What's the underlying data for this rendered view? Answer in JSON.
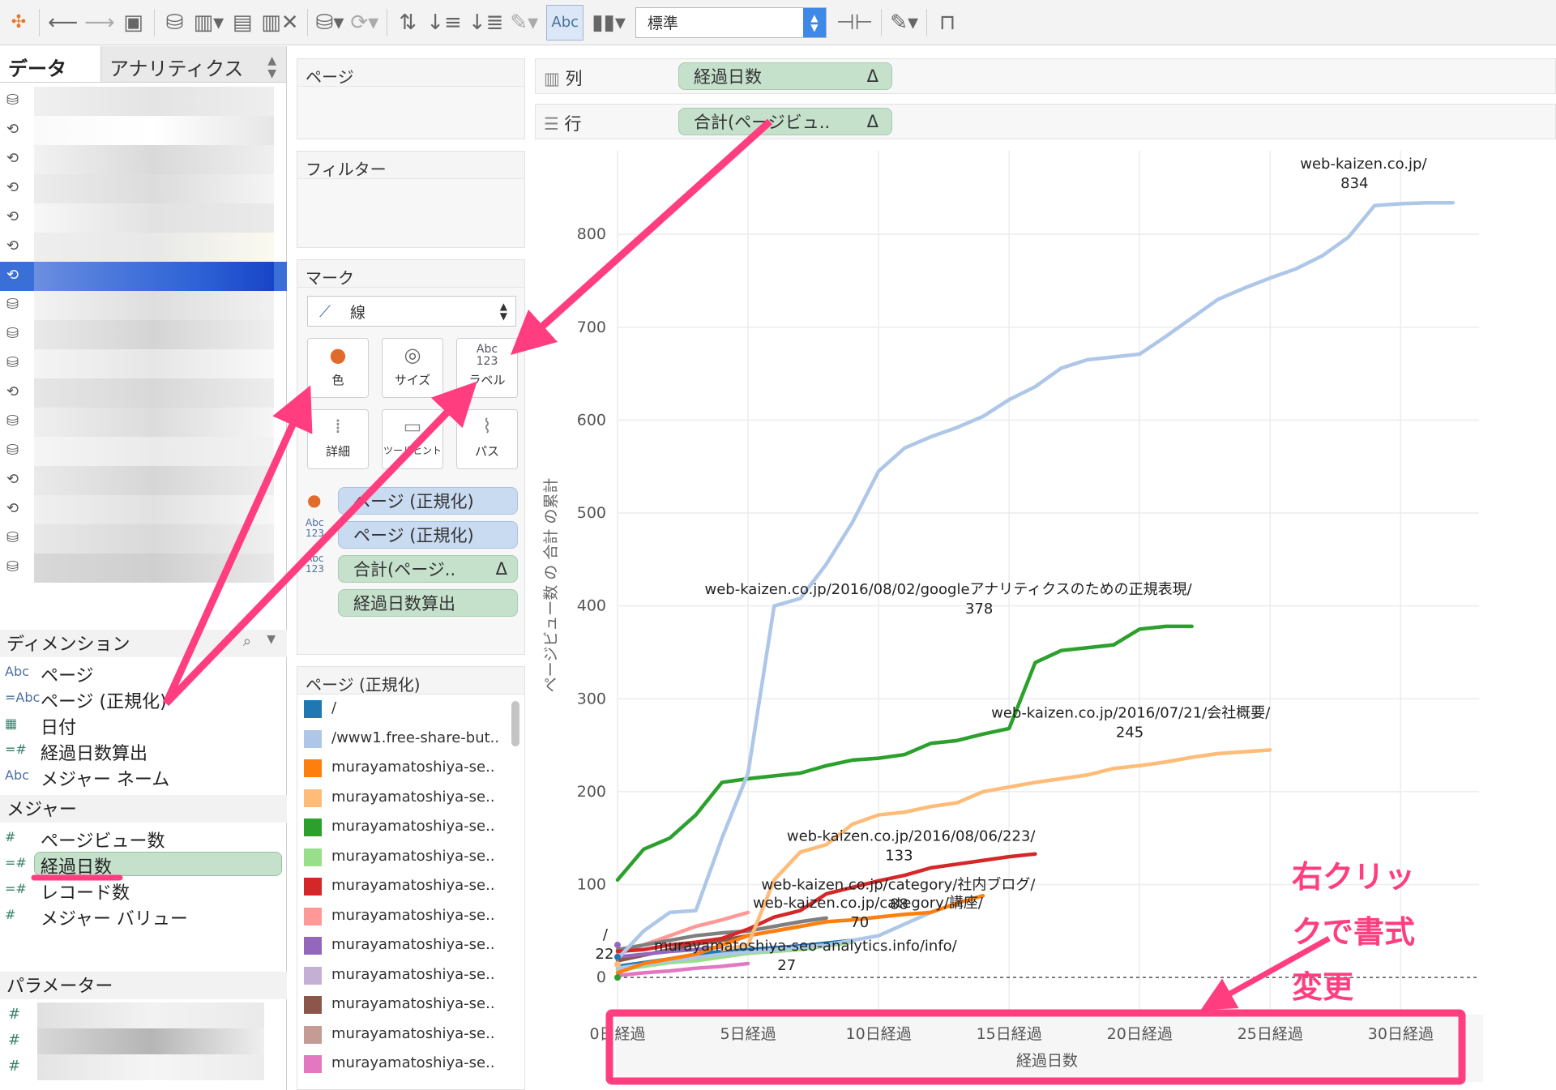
{
  "toolbar": {
    "abc_label": "Abc",
    "fit_select": "標準"
  },
  "left_panel": {
    "tabs": [
      "データ",
      "アナリティクス"
    ],
    "dimensions_header": "ディメンション",
    "dimensions": [
      {
        "type": "Abc",
        "name": "ページ"
      },
      {
        "type": "=Abc",
        "name": "ページ (正規化)"
      },
      {
        "type": "date",
        "name": "日付"
      },
      {
        "type": "=#",
        "name": "経過日数算出"
      },
      {
        "type": "Abc",
        "name": "メジャー ネーム"
      }
    ],
    "measures_header": "メジャー",
    "measures": [
      {
        "type": "#",
        "name": "ページビュー数"
      },
      {
        "type": "=#",
        "name": "経過日数"
      },
      {
        "type": "=#",
        "name": "レコード数"
      },
      {
        "type": "#",
        "name": "メジャー バリュー"
      }
    ],
    "parameters_header": "パラメーター"
  },
  "cards": {
    "pages": "ページ",
    "filters": "フィルター",
    "marks": "マーク",
    "mark_type": "線",
    "buttons": [
      "色",
      "サイズ",
      "ラベル",
      "詳細",
      "ツールヒント",
      "パス"
    ],
    "label_icon": [
      "Abc",
      "123"
    ],
    "mark_pills": [
      "ページ (正規化)",
      "ページ (正規化)",
      "合計(ページ..",
      "経過日数算出"
    ],
    "legend_title": "ページ (正規化)",
    "legend": [
      {
        "label": "/",
        "color": "#1f77b4"
      },
      {
        "label": "/www1.free-share-but..",
        "color": "#aec7e8"
      },
      {
        "label": "murayamatoshiya-se..",
        "color": "#ff7f0e"
      },
      {
        "label": "murayamatoshiya-se..",
        "color": "#ffbb78"
      },
      {
        "label": "murayamatoshiya-se..",
        "color": "#2ca02c"
      },
      {
        "label": "murayamatoshiya-se..",
        "color": "#98df8a"
      },
      {
        "label": "murayamatoshiya-se..",
        "color": "#d62728"
      },
      {
        "label": "murayamatoshiya-se..",
        "color": "#ff9896"
      },
      {
        "label": "murayamatoshiya-se..",
        "color": "#9467bd"
      },
      {
        "label": "murayamatoshiya-se..",
        "color": "#c5b0d5"
      },
      {
        "label": "murayamatoshiya-se..",
        "color": "#8c564b"
      },
      {
        "label": "murayamatoshiya-se..",
        "color": "#c49c94"
      },
      {
        "label": "murayamatoshiya-se..",
        "color": "#e377c2"
      }
    ]
  },
  "shelves": {
    "columns_label": "列",
    "columns_pill": "経過日数",
    "rows_label": "行",
    "rows_pill": "合計(ページビュ..",
    "delta": "Δ"
  },
  "chart_data": {
    "type": "line",
    "ylabel": "ページビュー数 の 合計 の累計",
    "xlabel": "経過日数",
    "ylim": [
      -40,
      890
    ],
    "xlim": [
      0,
      33
    ],
    "y_ticks": [
      0,
      100,
      200,
      300,
      400,
      500,
      600,
      700,
      800
    ],
    "x_ticks": [
      {
        "v": 0,
        "label": "0日経過"
      },
      {
        "v": 5,
        "label": "5日経過"
      },
      {
        "v": 10,
        "label": "10日経過"
      },
      {
        "v": 15,
        "label": "15日経過"
      },
      {
        "v": 20,
        "label": "20日経過"
      },
      {
        "v": 25,
        "label": "25日経過"
      },
      {
        "v": 30,
        "label": "30日経過"
      }
    ],
    "series": [
      {
        "color": "#aec7e8",
        "x": [
          0,
          1,
          2,
          3,
          4,
          5,
          6,
          7,
          8,
          9,
          10,
          11,
          12,
          13,
          14,
          15,
          16,
          17,
          18,
          19,
          20,
          21,
          22,
          23,
          24,
          25,
          26,
          27,
          28,
          29,
          30,
          31,
          32
        ],
        "y": [
          20,
          50,
          70,
          72,
          150,
          220,
          400,
          408,
          445,
          490,
          545,
          570,
          582,
          592,
          604,
          622,
          636,
          656,
          665,
          668,
          671,
          690,
          710,
          730,
          742,
          753,
          763,
          777,
          797,
          831,
          833,
          834,
          834
        ]
      },
      {
        "color": "#2ca02c",
        "x": [
          0,
          1,
          2,
          3,
          4,
          5,
          6,
          7,
          8,
          9,
          10,
          11,
          12,
          13,
          14,
          15,
          16,
          17,
          18,
          19,
          20,
          21,
          22
        ],
        "y": [
          105,
          138,
          150,
          175,
          210,
          214,
          217,
          220,
          228,
          234,
          236,
          240,
          252,
          255,
          262,
          268,
          339,
          352,
          355,
          358,
          375,
          378,
          378
        ]
      },
      {
        "color": "#ffbb78",
        "x": [
          4,
          5,
          6,
          7,
          8,
          9,
          10,
          11,
          12,
          13,
          14,
          15,
          16,
          17,
          18,
          19,
          20,
          21,
          22,
          23,
          24,
          25
        ],
        "y": [
          30,
          35,
          105,
          135,
          143,
          165,
          175,
          178,
          184,
          188,
          200,
          205,
          210,
          214,
          218,
          225,
          228,
          232,
          237,
          241,
          243,
          245
        ]
      },
      {
        "color": "#d62728",
        "x": [
          0,
          1,
          2,
          3,
          4,
          5,
          6,
          7,
          8,
          9,
          10,
          11,
          12,
          13,
          14,
          15,
          16
        ],
        "y": [
          28,
          30,
          35,
          38,
          42,
          52,
          65,
          72,
          90,
          97,
          104,
          110,
          118,
          122,
          126,
          130,
          133
        ]
      },
      {
        "color": "#ff7f0e",
        "x": [
          0,
          1,
          2,
          3,
          4,
          5,
          6,
          7,
          8,
          9,
          10,
          11,
          12,
          13,
          14
        ],
        "y": [
          5,
          15,
          20,
          25,
          35,
          45,
          50,
          55,
          60,
          62,
          65,
          68,
          70,
          80,
          88
        ]
      },
      {
        "color": "#aec7e8",
        "x": [
          0,
          2,
          4,
          6,
          8,
          10,
          12
        ],
        "y": [
          10,
          18,
          25,
          30,
          35,
          45,
          70
        ]
      },
      {
        "color": "#7f7f7f",
        "x": [
          0,
          1,
          2,
          3,
          4,
          5,
          6,
          7,
          8
        ],
        "y": [
          30,
          35,
          40,
          45,
          48,
          50,
          55,
          60,
          64
        ]
      },
      {
        "color": "#1f77b4",
        "x": [
          0,
          1,
          2,
          3,
          4,
          5,
          6,
          7,
          8,
          9
        ],
        "y": [
          12,
          16,
          20,
          25,
          28,
          30,
          32,
          34,
          37,
          40
        ]
      },
      {
        "color": "#98df8a",
        "x": [
          0,
          1,
          2,
          3,
          4,
          5,
          6,
          7,
          8,
          9
        ],
        "y": [
          8,
          12,
          16,
          18,
          22,
          26,
          28,
          30,
          34,
          38
        ]
      },
      {
        "color": "#ff9896",
        "x": [
          0,
          1,
          2,
          3,
          4,
          5
        ],
        "y": [
          25,
          35,
          45,
          55,
          62,
          70
        ]
      },
      {
        "color": "#e377c2",
        "x": [
          0,
          1,
          2,
          3,
          4,
          5
        ],
        "y": [
          2,
          5,
          7,
          10,
          12,
          15
        ]
      },
      {
        "color": "#9467bd",
        "x": [
          0,
          1,
          2,
          3,
          4
        ],
        "y": [
          22,
          25,
          28,
          30,
          33
        ]
      },
      {
        "color": "#8c564b",
        "x": [
          0,
          1,
          2,
          3,
          4,
          5,
          6,
          7
        ],
        "y": [
          18,
          24,
          30,
          36,
          40,
          45,
          50,
          55
        ]
      }
    ],
    "labels": [
      {
        "text": "web-kaizen.co.jp/",
        "value": "834"
      },
      {
        "text": "web-kaizen.co.jp/2016/08/02/googleアナリティクスのための正規表現/",
        "value": "378"
      },
      {
        "text": "web-kaizen.co.jp/2016/07/21/会社概要/",
        "value": "245"
      },
      {
        "text": "web-kaizen.co.jp/2016/08/06/223/",
        "value": "133"
      },
      {
        "text": "web-kaizen.co.jp/category/社内ブログ/",
        "value": "88"
      },
      {
        "text": "web-kaizen.co.jp/category/講座/",
        "value": "70"
      },
      {
        "text": "murayamatoshiya-seo-analytics.info/info/",
        "value": "27"
      },
      {
        "text": "/",
        "value": "22"
      }
    ]
  },
  "annotation": {
    "lines": [
      "右クリッ",
      "クで書式",
      "変更"
    ],
    "color": "#ff3d7f"
  }
}
